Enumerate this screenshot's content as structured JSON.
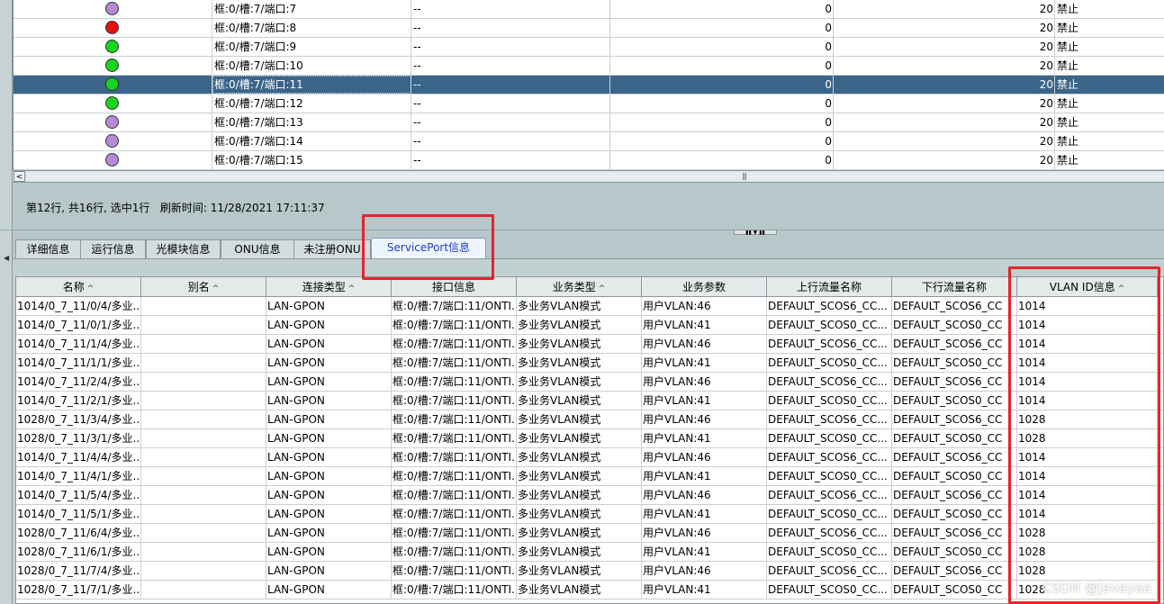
{
  "top_table": {
    "rows": [
      {
        "status_color": "#b58ad6",
        "port": "框:0/槽:7/端口:7",
        "desc": "--",
        "num": "0",
        "num2": "20",
        "state": "禁止",
        "selected": false
      },
      {
        "status_color": "#e8100c",
        "port": "框:0/槽:7/端口:8",
        "desc": "--",
        "num": "0",
        "num2": "20",
        "state": "禁止",
        "selected": false
      },
      {
        "status_color": "#17d41d",
        "port": "框:0/槽:7/端口:9",
        "desc": "--",
        "num": "0",
        "num2": "20",
        "state": "禁止",
        "selected": false
      },
      {
        "status_color": "#17d41d",
        "port": "框:0/槽:7/端口:10",
        "desc": "--",
        "num": "0",
        "num2": "20",
        "state": "禁止",
        "selected": false
      },
      {
        "status_color": "#17d41d",
        "port": "框:0/槽:7/端口:11",
        "desc": "--",
        "num": "0",
        "num2": "20",
        "state": "禁止",
        "selected": true
      },
      {
        "status_color": "#17d41d",
        "port": "框:0/槽:7/端口:12",
        "desc": "--",
        "num": "0",
        "num2": "20",
        "state": "禁止",
        "selected": false
      },
      {
        "status_color": "#b58ad6",
        "port": "框:0/槽:7/端口:13",
        "desc": "--",
        "num": "0",
        "num2": "20",
        "state": "禁止",
        "selected": false
      },
      {
        "status_color": "#b58ad6",
        "port": "框:0/槽:7/端口:14",
        "desc": "--",
        "num": "0",
        "num2": "20",
        "state": "禁止",
        "selected": false
      },
      {
        "status_color": "#b58ad6",
        "port": "框:0/槽:7/端口:15",
        "desc": "--",
        "num": "0",
        "num2": "20",
        "state": "禁止",
        "selected": false
      }
    ]
  },
  "status": {
    "summary": "第12行, 共16行, 选中1行",
    "refresh_label": "刷新时间:",
    "refresh_time": "11/28/2021 17:11:37"
  },
  "tabs": [
    {
      "label": "详细信息",
      "active": false
    },
    {
      "label": "运行信息",
      "active": false
    },
    {
      "label": "光模块信息",
      "active": false
    },
    {
      "label": "ONU信息",
      "active": false
    },
    {
      "label": "未注册ONU",
      "active": false
    },
    {
      "label": "ServicePort信息",
      "active": true
    }
  ],
  "service_table": {
    "columns": [
      "名称",
      "别名",
      "连接类型",
      "接口信息",
      "业务类型",
      "业务参数",
      "上行流量名称",
      "下行流量名称",
      "VLAN ID信息"
    ],
    "sortable": [
      true,
      true,
      true,
      false,
      true,
      false,
      false,
      false,
      true
    ],
    "rows": [
      [
        "1014/0_7_11/0/4/多业...",
        "",
        "LAN-GPON",
        "框:0/槽:7/端口:11/ONTI...",
        "多业务VLAN模式",
        "用户VLAN:46",
        "DEFAULT_SCOS6_CC...",
        "DEFAULT_SCOS6_CC",
        "1014"
      ],
      [
        "1014/0_7_11/0/1/多业...",
        "",
        "LAN-GPON",
        "框:0/槽:7/端口:11/ONTI...",
        "多业务VLAN模式",
        "用户VLAN:41",
        "DEFAULT_SCOS0_CC...",
        "DEFAULT_SCOS0_CC",
        "1014"
      ],
      [
        "1014/0_7_11/1/4/多业...",
        "",
        "LAN-GPON",
        "框:0/槽:7/端口:11/ONTI...",
        "多业务VLAN模式",
        "用户VLAN:46",
        "DEFAULT_SCOS6_CC...",
        "DEFAULT_SCOS6_CC",
        "1014"
      ],
      [
        "1014/0_7_11/1/1/多业...",
        "",
        "LAN-GPON",
        "框:0/槽:7/端口:11/ONTI...",
        "多业务VLAN模式",
        "用户VLAN:41",
        "DEFAULT_SCOS0_CC...",
        "DEFAULT_SCOS0_CC",
        "1014"
      ],
      [
        "1014/0_7_11/2/4/多业...",
        "",
        "LAN-GPON",
        "框:0/槽:7/端口:11/ONTI...",
        "多业务VLAN模式",
        "用户VLAN:46",
        "DEFAULT_SCOS6_CC...",
        "DEFAULT_SCOS6_CC",
        "1014"
      ],
      [
        "1014/0_7_11/2/1/多业...",
        "",
        "LAN-GPON",
        "框:0/槽:7/端口:11/ONTI...",
        "多业务VLAN模式",
        "用户VLAN:41",
        "DEFAULT_SCOS0_CC...",
        "DEFAULT_SCOS0_CC",
        "1014"
      ],
      [
        "1028/0_7_11/3/4/多业...",
        "",
        "LAN-GPON",
        "框:0/槽:7/端口:11/ONTI...",
        "多业务VLAN模式",
        "用户VLAN:46",
        "DEFAULT_SCOS6_CC...",
        "DEFAULT_SCOS6_CC",
        "1028"
      ],
      [
        "1028/0_7_11/3/1/多业...",
        "",
        "LAN-GPON",
        "框:0/槽:7/端口:11/ONTI...",
        "多业务VLAN模式",
        "用户VLAN:41",
        "DEFAULT_SCOS0_CC...",
        "DEFAULT_SCOS0_CC",
        "1028"
      ],
      [
        "1014/0_7_11/4/4/多业...",
        "",
        "LAN-GPON",
        "框:0/槽:7/端口:11/ONTI...",
        "多业务VLAN模式",
        "用户VLAN:46",
        "DEFAULT_SCOS6_CC...",
        "DEFAULT_SCOS6_CC",
        "1014"
      ],
      [
        "1014/0_7_11/4/1/多业...",
        "",
        "LAN-GPON",
        "框:0/槽:7/端口:11/ONTI...",
        "多业务VLAN模式",
        "用户VLAN:41",
        "DEFAULT_SCOS0_CC...",
        "DEFAULT_SCOS0_CC",
        "1014"
      ],
      [
        "1014/0_7_11/5/4/多业...",
        "",
        "LAN-GPON",
        "框:0/槽:7/端口:11/ONTI...",
        "多业务VLAN模式",
        "用户VLAN:46",
        "DEFAULT_SCOS6_CC...",
        "DEFAULT_SCOS6_CC",
        "1014"
      ],
      [
        "1014/0_7_11/5/1/多业...",
        "",
        "LAN-GPON",
        "框:0/槽:7/端口:11/ONTI...",
        "多业务VLAN模式",
        "用户VLAN:41",
        "DEFAULT_SCOS0_CC...",
        "DEFAULT_SCOS0_CC",
        "1014"
      ],
      [
        "1028/0_7_11/6/4/多业...",
        "",
        "LAN-GPON",
        "框:0/槽:7/端口:11/ONTI...",
        "多业务VLAN模式",
        "用户VLAN:46",
        "DEFAULT_SCOS6_CC...",
        "DEFAULT_SCOS6_CC",
        "1028"
      ],
      [
        "1028/0_7_11/6/1/多业...",
        "",
        "LAN-GPON",
        "框:0/槽:7/端口:11/ONTI...",
        "多业务VLAN模式",
        "用户VLAN:41",
        "DEFAULT_SCOS0_CC...",
        "DEFAULT_SCOS0_CC",
        "1028"
      ],
      [
        "1028/0_7_11/7/4/多业...",
        "",
        "LAN-GPON",
        "框:0/槽:7/端口:11/ONTI...",
        "多业务VLAN模式",
        "用户VLAN:46",
        "DEFAULT_SCOS6_CC...",
        "DEFAULT_SCOS6_CC",
        "1028"
      ],
      [
        "1028/0_7_11/7/1/多业...",
        "",
        "LAN-GPON",
        "框:0/槽:7/端口:11/ONTI...",
        "多业务VLAN模式",
        "用户VLAN:41",
        "DEFAULT_SCOS0_CC...",
        "DEFAULT_SCOS0_CC",
        "1028"
      ]
    ]
  },
  "watermark": "CSDN @Javayaa",
  "colors": {
    "selected_row": "#3b6489",
    "annotation_red": "#e8232a",
    "active_tab_text": "#1d3bd2"
  }
}
